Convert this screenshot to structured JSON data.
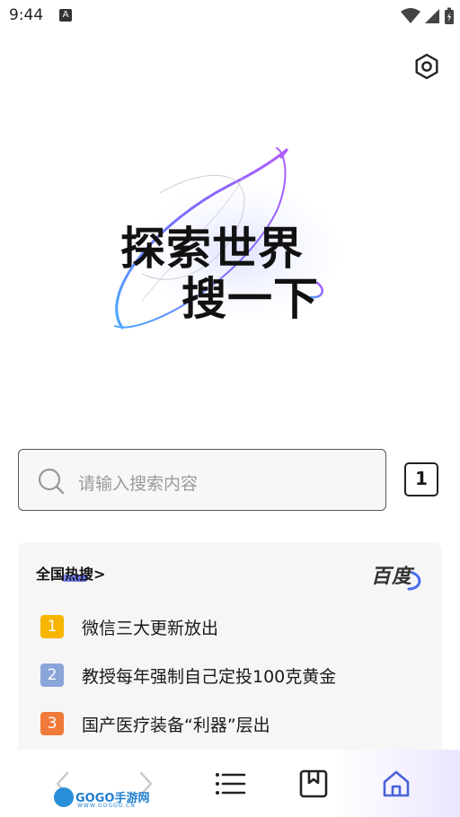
{
  "status_bar": {
    "time": "9:44",
    "notification_icon": "A"
  },
  "hero": {
    "line1": "探索世界",
    "line2": "搜一下"
  },
  "search": {
    "placeholder": "请输入搜索内容"
  },
  "tabs": {
    "count": "1"
  },
  "hot_search": {
    "title": "全国热搜>",
    "source": "百度",
    "items": [
      {
        "rank": "1",
        "text": "微信三大更新放出",
        "color": "#f7b500"
      },
      {
        "rank": "2",
        "text": "教授每年强制自己定投100克黄金",
        "color": "#8aa5d8"
      },
      {
        "rank": "3",
        "text": "国产医疗装备“利器”层出",
        "color": "#f07a3a"
      }
    ]
  },
  "watermark": {
    "brand": "GOGO手游网",
    "sub": "WWW.GOGOO.CN"
  },
  "colors": {
    "accent": "#5b6cf0",
    "nav_home": "#4a62d8"
  }
}
